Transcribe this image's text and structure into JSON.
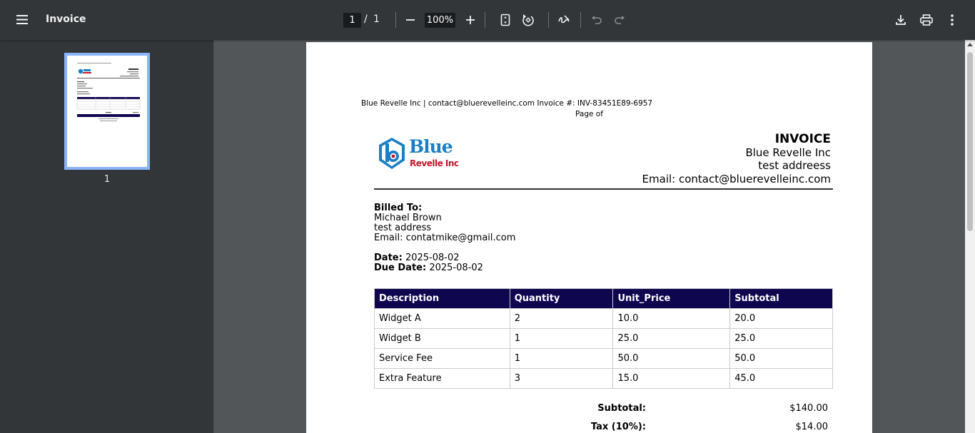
{
  "toolbar": {
    "title": "Invoice",
    "current_page": "1",
    "page_separator": "/",
    "total_pages": "1",
    "zoom": "100%"
  },
  "sidebar": {
    "thumbnail_label": "1"
  },
  "document": {
    "header_line": "Blue Revelle Inc | contact@bluerevelleinc.com Invoice #: INV-83451E89-6957",
    "page_line": "Page of",
    "logo_text_top": "Blue",
    "logo_text_bottom": "Revelle Inc",
    "invoice_title": "INVOICE",
    "company_name": "Blue Revelle Inc",
    "company_address": "test addreess",
    "company_email": "Email: contact@bluerevelleinc.com",
    "billed_to_label": "Billed To:",
    "client_name": "Michael Brown",
    "client_address": "test address",
    "client_email": "Email: contatmike@gmail.com",
    "date_label": "Date:",
    "date_value": "2025-08-02",
    "due_label": "Due Date:",
    "due_value": "2025-08-02",
    "table": {
      "headers": [
        "Description",
        "Quantity",
        "Unit_Price",
        "Subtotal"
      ],
      "rows": [
        [
          "Widget A",
          "2",
          "10.0",
          "20.0"
        ],
        [
          "Widget B",
          "1",
          "25.0",
          "25.0"
        ],
        [
          "Service Fee",
          "1",
          "50.0",
          "50.0"
        ],
        [
          "Extra Feature",
          "3",
          "15.0",
          "45.0"
        ]
      ]
    },
    "subtotal_label": "Subtotal:",
    "subtotal_value": "$140.00",
    "tax_label": "Tax (10%):",
    "tax_value": "$14.00"
  },
  "colors": {
    "toolbar_bg": "#323639",
    "viewer_bg": "#525659",
    "table_header_bg": "#0f0650",
    "logo_blue": "#1a7fc4",
    "logo_red": "#c4162a",
    "thumbnail_border": "#8ab4f8"
  }
}
